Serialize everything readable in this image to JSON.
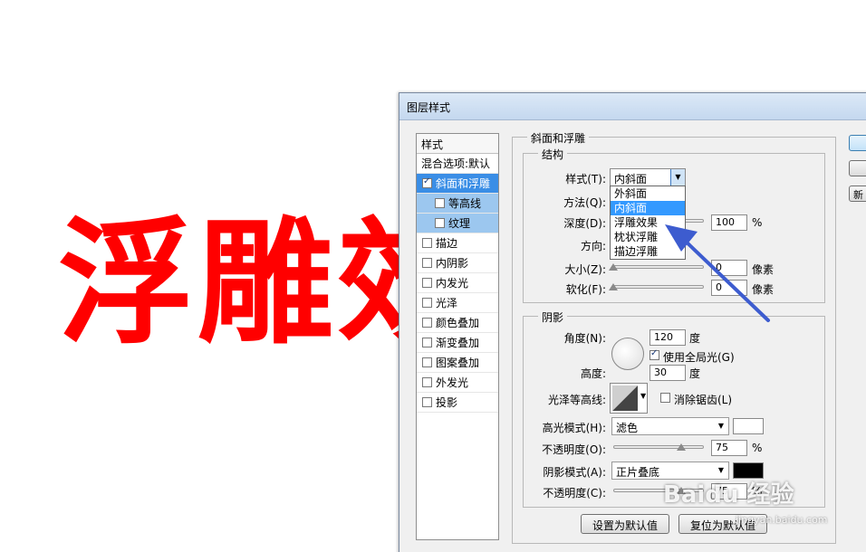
{
  "canvas": {
    "text": "浮雕效"
  },
  "dialog": {
    "title": "图层样式",
    "styles_panel": {
      "header": "样式",
      "blend_options": "混合选项:默认",
      "items": [
        {
          "label": "斜面和浮雕",
          "checked": true,
          "state": "selected"
        },
        {
          "label": "等高线",
          "checked": false,
          "state": "sub"
        },
        {
          "label": "纹理",
          "checked": false,
          "state": "sub"
        },
        {
          "label": "描边",
          "checked": false
        },
        {
          "label": "内阴影",
          "checked": false
        },
        {
          "label": "内发光",
          "checked": false
        },
        {
          "label": "光泽",
          "checked": false
        },
        {
          "label": "颜色叠加",
          "checked": false
        },
        {
          "label": "渐变叠加",
          "checked": false
        },
        {
          "label": "图案叠加",
          "checked": false
        },
        {
          "label": "外发光",
          "checked": false
        },
        {
          "label": "投影",
          "checked": false
        }
      ]
    },
    "bevel": {
      "title": "斜面和浮雕",
      "structure": {
        "title": "结构",
        "style_label": "样式(T):",
        "style_value": "内斜面",
        "method_label": "方法(Q):",
        "depth_label": "深度(D):",
        "depth_value": "100",
        "depth_unit": "%",
        "direction_label": "方向:",
        "size_label": "大小(Z):",
        "size_value": "0",
        "size_unit": "像素",
        "soften_label": "软化(F):",
        "soften_value": "0",
        "soften_unit": "像素",
        "style_options": [
          "外斜面",
          "内斜面",
          "浮雕效果",
          "枕状浮雕",
          "描边浮雕"
        ],
        "style_selected_index": 1
      },
      "shading": {
        "title": "阴影",
        "angle_label": "角度(N):",
        "angle_value": "120",
        "angle_unit": "度",
        "global_light_label": "使用全局光(G)",
        "global_light_checked": true,
        "altitude_label": "高度:",
        "altitude_value": "30",
        "altitude_unit": "度",
        "gloss_contour_label": "光泽等高线:",
        "anti_alias_label": "消除锯齿(L)",
        "highlight_mode_label": "高光模式(H):",
        "highlight_mode_value": "滤色",
        "highlight_color": "#ffffff",
        "highlight_opacity_label": "不透明度(O):",
        "highlight_opacity_value": "75",
        "highlight_opacity_unit": "%",
        "shadow_mode_label": "阴影模式(A):",
        "shadow_mode_value": "正片叠底",
        "shadow_color": "#000000",
        "shadow_opacity_label": "不透明度(C):",
        "shadow_opacity_value": "75",
        "shadow_opacity_unit": "%"
      },
      "set_default_button": "设置为默认值",
      "reset_default_button": "复位为默认值"
    },
    "side_buttons": {
      "third_label": "新"
    }
  },
  "watermark": {
    "text": "Baidu 经验",
    "sub": "jingyan.baidu.com"
  },
  "colors": {
    "canvas_text": "#ff0000",
    "selection": "#3a8ee6",
    "annotation_arrow": "#3d5ccf"
  }
}
